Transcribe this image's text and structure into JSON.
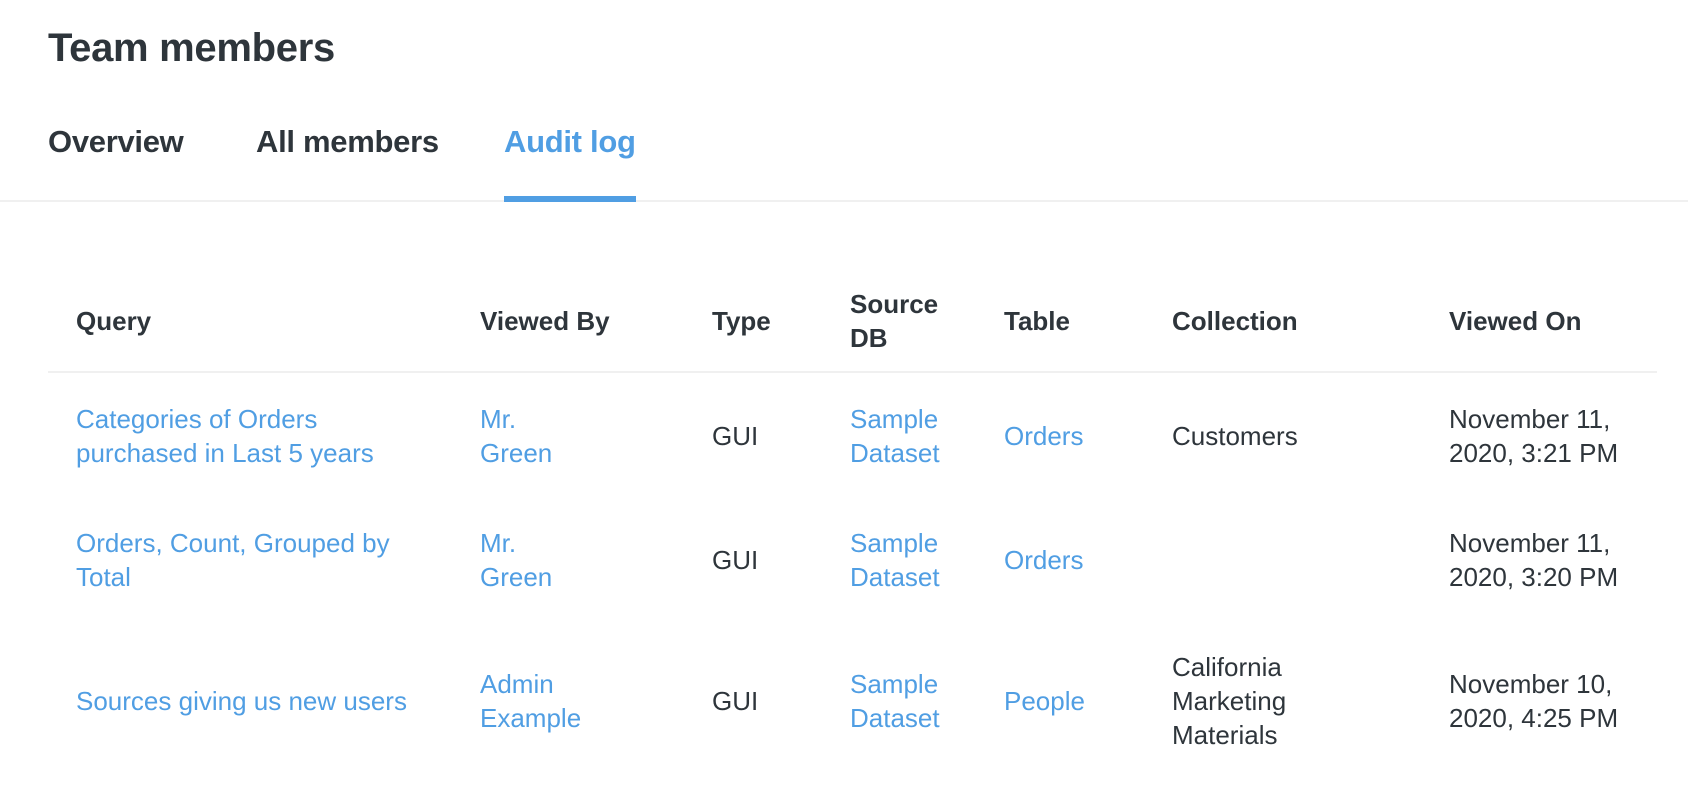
{
  "page": {
    "title": "Team members"
  },
  "tabs": [
    {
      "label": "Overview",
      "active": false
    },
    {
      "label": "All members",
      "active": false
    },
    {
      "label": "Audit log",
      "active": true
    }
  ],
  "colors": {
    "accent": "#509ee3",
    "text": "#2e353b",
    "divider": "#f0f0f0"
  },
  "audit_table": {
    "columns": [
      "Query",
      "Viewed By",
      "Type",
      "Source DB",
      "Table",
      "Collection",
      "Viewed On"
    ],
    "rows": [
      {
        "query": "Categories of Orders purchased in Last 5 years",
        "viewed_by": "Mr. Green",
        "type": "GUI",
        "source_db": "Sample Dataset",
        "table": "Orders",
        "collection": "Customers",
        "viewed_on": "November 11, 2020, 3:21 PM"
      },
      {
        "query": "Orders, Count, Grouped by Total",
        "viewed_by": "Mr. Green",
        "type": "GUI",
        "source_db": "Sample Dataset",
        "table": "Orders",
        "collection": "",
        "viewed_on": "November 11, 2020, 3:20 PM"
      },
      {
        "query": "Sources giving us new users",
        "viewed_by": "Admin Example",
        "type": "GUI",
        "source_db": "Sample Dataset",
        "table": "People",
        "collection": "California Marketing Materials",
        "viewed_on": "November 10, 2020, 4:25 PM"
      }
    ]
  }
}
